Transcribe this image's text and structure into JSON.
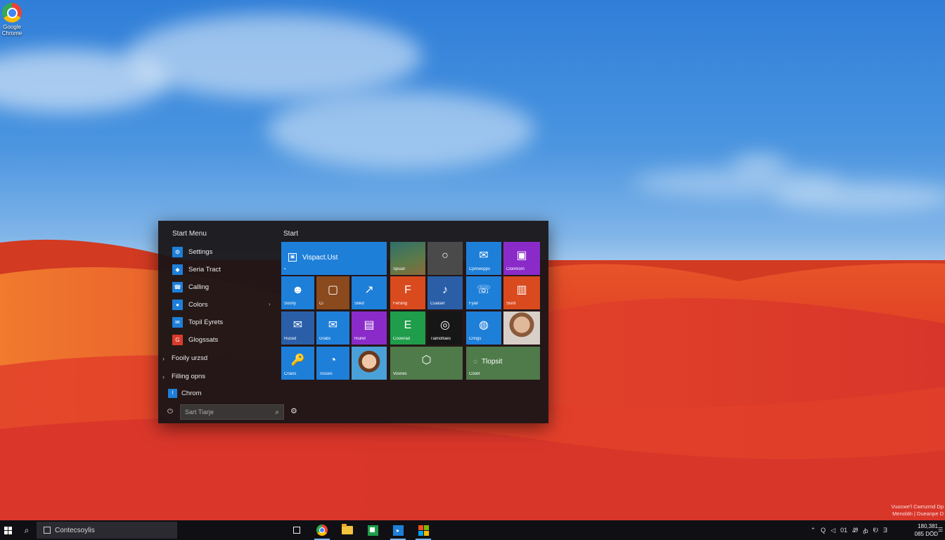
{
  "desktop": {
    "icon_label": "Google Chrome"
  },
  "start_menu": {
    "title": "Start Menu",
    "apps": [
      {
        "label": "Settings",
        "glyph": "⚙"
      },
      {
        "label": "Seria Tract",
        "glyph": "◆"
      },
      {
        "label": "Calling",
        "glyph": "☎"
      },
      {
        "label": "Colors",
        "glyph": "●"
      },
      {
        "label": "Topil Eyrets",
        "glyph": "✉"
      },
      {
        "label": "Glogssats",
        "glyph": "G"
      }
    ],
    "groups": [
      "Fooily urzsd",
      "Filling opns"
    ],
    "chrome_item": "Chrom",
    "search_placeholder": "Sart Tiarje",
    "tiles_title": "Start",
    "tiles": [
      {
        "label": "Vispact.Ust",
        "glyph": "▣",
        "color": "#1e7fd9"
      },
      {
        "label": "Spuuir",
        "glyph": "",
        "color": "#3f6b5a"
      },
      {
        "label": "",
        "glyph": "○",
        "color": "#4a4a4a"
      },
      {
        "label": "Cpmwopps",
        "glyph": "✉",
        "color": "#1e7fd9"
      },
      {
        "label": "Clonmorn",
        "glyph": "▣",
        "color": "#8a2bc9"
      },
      {
        "label": "Soony",
        "glyph": "👤",
        "color": "#1e7fd9"
      },
      {
        "label": "Ci",
        "glyph": "▢",
        "color": "#8a4a1e"
      },
      {
        "label": "Sited",
        "glyph": "↗",
        "color": "#1e7fd9"
      },
      {
        "label": "Fersing",
        "glyph": "F",
        "color": "#d94a1e"
      },
      {
        "label": "Cuiaser",
        "glyph": "♪",
        "color": "#2a5fa8"
      },
      {
        "label": "Fyan",
        "glyph": "☏",
        "color": "#1e7fd9"
      },
      {
        "label": "Sisnt",
        "glyph": "▥",
        "color": "#d94a1e"
      },
      {
        "label": "Ruced",
        "glyph": "✉",
        "color": "#2a5fa8"
      },
      {
        "label": "Grabs",
        "glyph": "✉",
        "color": "#1e7fd9"
      },
      {
        "label": "Ruiret",
        "glyph": "▤",
        "color": "#8a2bc9"
      },
      {
        "label": "Coowrad",
        "glyph": "E",
        "color": "#1f9d4a"
      },
      {
        "label": "Tialnottaes",
        "glyph": "◎",
        "color": "#1a1a1a"
      },
      {
        "label": "Cnngs",
        "glyph": "◍",
        "color": "#1e7fd9"
      },
      {
        "label": "",
        "glyph": "",
        "color": "#c9a08a"
      },
      {
        "label": "Cnaos",
        "glyph": "🔑",
        "color": "#1e7fd9"
      },
      {
        "label": "Tosses",
        "glyph": "◔",
        "color": "#1e7fd9"
      },
      {
        "label": "",
        "glyph": "",
        "color": "#4aa0d8"
      },
      {
        "label": "Vosnes",
        "glyph": "⬡",
        "color": "#4f7a4a"
      },
      {
        "label": "",
        "glyph": "◪",
        "color": "#4f7a4a"
      },
      {
        "label": "Coolir",
        "glyph": "",
        "color": "#4f7a4a"
      }
    ],
    "wide_tile_text": "Tlopsit"
  },
  "taskbar": {
    "cortana_text": "Contecsoylis",
    "tray": [
      "⌃",
      "Q",
      "◁",
      "01",
      "Ꮺ",
      "ꞗ",
      "Ꭷ",
      "Ǝ"
    ],
    "clock_line1": "180,381",
    "clock_line2": "085 DÖD",
    "notif_glyph": "☰"
  },
  "watermark": {
    "line1": "Vuocwe'l Cwmzmd Dp",
    "line2": "Menoldn | Dueanpe D"
  }
}
